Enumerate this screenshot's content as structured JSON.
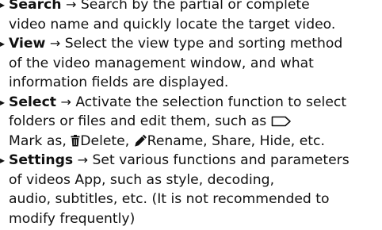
{
  "items": [
    {
      "term": "Search",
      "arrow": "→",
      "lines": [
        " Search by the partial or complete",
        "video name and quickly locate the target video."
      ]
    },
    {
      "term": "View",
      "arrow": "→",
      "lines": [
        " Select the view type and sorting method",
        "of the video management window, and what",
        "information fields are displayed."
      ]
    },
    {
      "term": "Select",
      "arrow": "→",
      "lines": [
        " Activate the selection function to select",
        "folders or files and edit them, such as",
        "Mark as,",
        "Delete,",
        "Rename, Share, Hide, etc."
      ]
    },
    {
      "term": "Settings",
      "arrow": "→",
      "lines": [
        " Set various functions and parameters",
        "of videos App, such as style, decoding,",
        "audio, subtitles, etc. (It is not recommended to",
        "modify frequently)"
      ]
    }
  ],
  "bullet_glyph": "▸",
  "icons": [
    "tag-outline-icon",
    "trash-icon",
    "pencil-icon"
  ]
}
